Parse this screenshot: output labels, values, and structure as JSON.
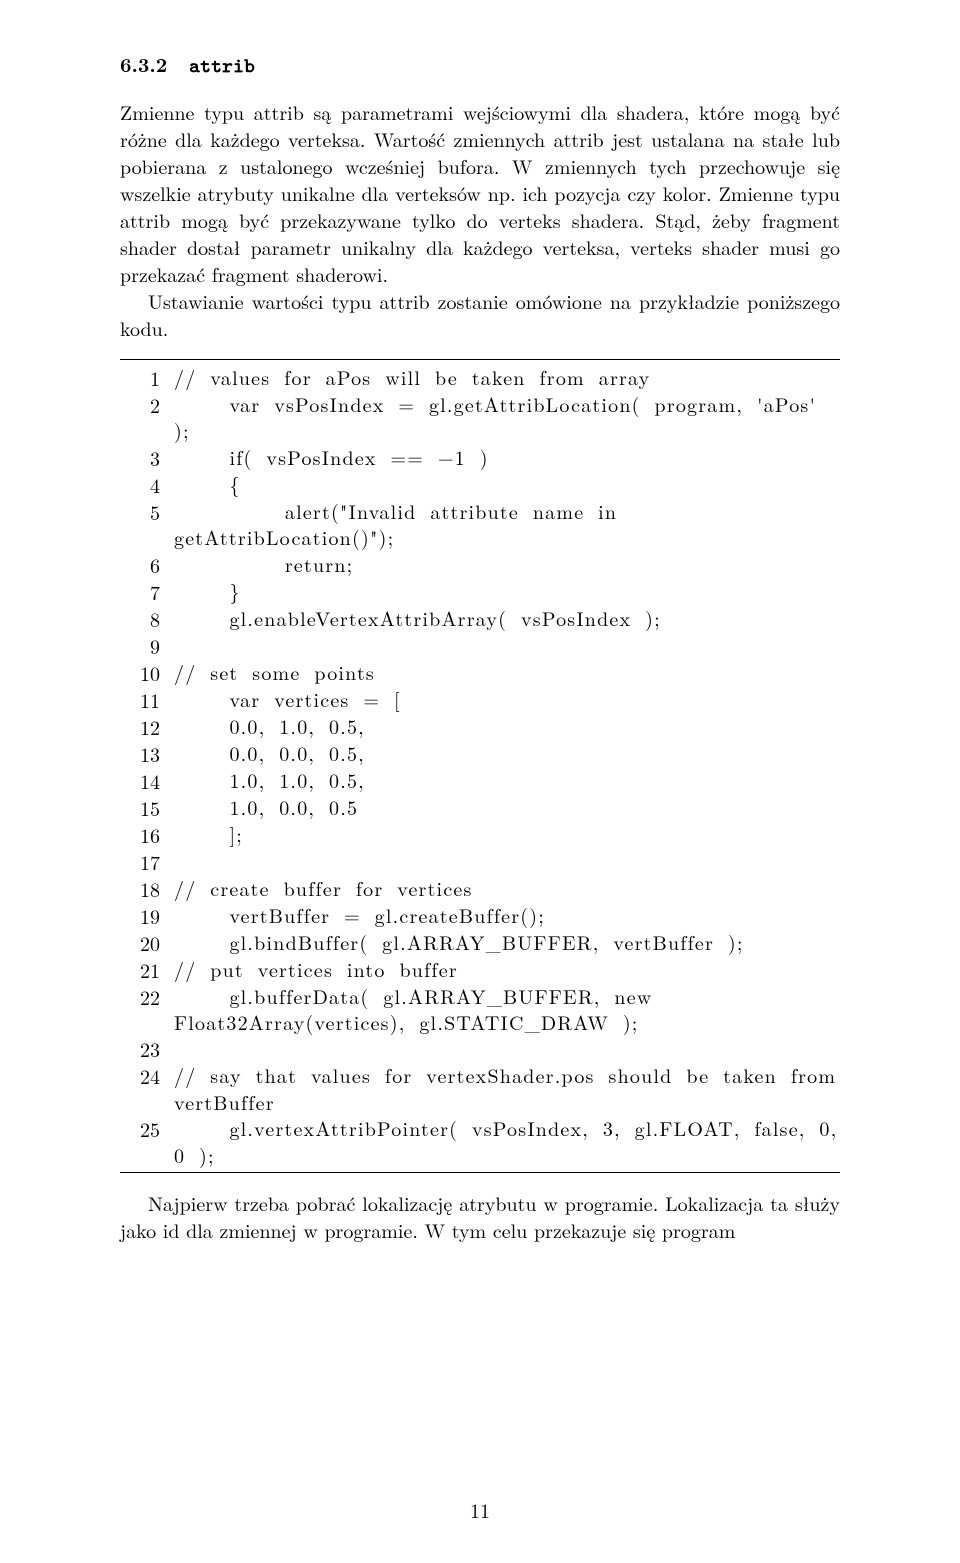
{
  "heading": {
    "number": "6.3.2",
    "title": "attrib"
  },
  "para1": "Zmienne typu attrib są parametrami wejściowymi dla shadera, które mogą być różne dla każdego verteksa. Wartość zmiennych attrib jest ustalana na stałe lub pobierana z ustalonego wcześniej bufora. W zmiennych tych przechowuje się wszelkie atrybuty unikalne dla verteksów np. ich pozycja czy kolor. Zmienne typu attrib mogą być przekazywane tylko do verteks shadera. Stąd, żeby fragment shader dostał parametr unikalny dla każdego verteksa, verteks shader musi go przekazać fragment shaderowi.",
  "para2": "Ustawianie wartości typu attrib zostanie omówione na przykładzie poniższego kodu.",
  "code_lines": [
    {
      "n": "1",
      "t": "// values for aPos will be taken from array"
    },
    {
      "n": "2",
      "t": "    var vsPosIndex = gl.getAttribLocation( program, 'aPos' );"
    },
    {
      "n": "3",
      "t": "    if( vsPosIndex == −1 )"
    },
    {
      "n": "4",
      "t": "    {"
    },
    {
      "n": "5",
      "t": "        alert(\"Invalid attribute name in getAttribLocation()\");"
    },
    {
      "n": "6",
      "t": "        return;"
    },
    {
      "n": "7",
      "t": "    }"
    },
    {
      "n": "8",
      "t": "    gl.enableVertexAttribArray( vsPosIndex );"
    },
    {
      "n": "9",
      "t": ""
    },
    {
      "n": "10",
      "t": "// set some points"
    },
    {
      "n": "11",
      "t": "    var vertices = ["
    },
    {
      "n": "12",
      "t": "    0.0, 1.0, 0.5,"
    },
    {
      "n": "13",
      "t": "    0.0, 0.0, 0.5,"
    },
    {
      "n": "14",
      "t": "    1.0, 1.0, 0.5,"
    },
    {
      "n": "15",
      "t": "    1.0, 0.0, 0.5"
    },
    {
      "n": "16",
      "t": "    ];"
    },
    {
      "n": "17",
      "t": ""
    },
    {
      "n": "18",
      "t": "// create buffer for vertices"
    },
    {
      "n": "19",
      "t": "    vertBuffer = gl.createBuffer();"
    },
    {
      "n": "20",
      "t": "    gl.bindBuffer( gl.ARRAY_BUFFER, vertBuffer );"
    },
    {
      "n": "21",
      "t": "// put vertices into buffer"
    },
    {
      "n": "22",
      "t": "    gl.bufferData( gl.ARRAY_BUFFER, new Float32Array(vertices), gl.STATIC_DRAW );"
    },
    {
      "n": "23",
      "t": ""
    },
    {
      "n": "24",
      "t": "// say that values for vertexShader.pos should be taken from vertBuffer"
    },
    {
      "n": "25",
      "t": "    gl.vertexAttribPointer( vsPosIndex, 3, gl.FLOAT, false, 0, 0 );"
    }
  ],
  "para3": "Najpierw trzeba pobrać lokalizację atrybutu w programie. Lokalizacja ta służy jako id dla zmiennej w programie. W tym celu przekazuje się program",
  "page_number": "11"
}
